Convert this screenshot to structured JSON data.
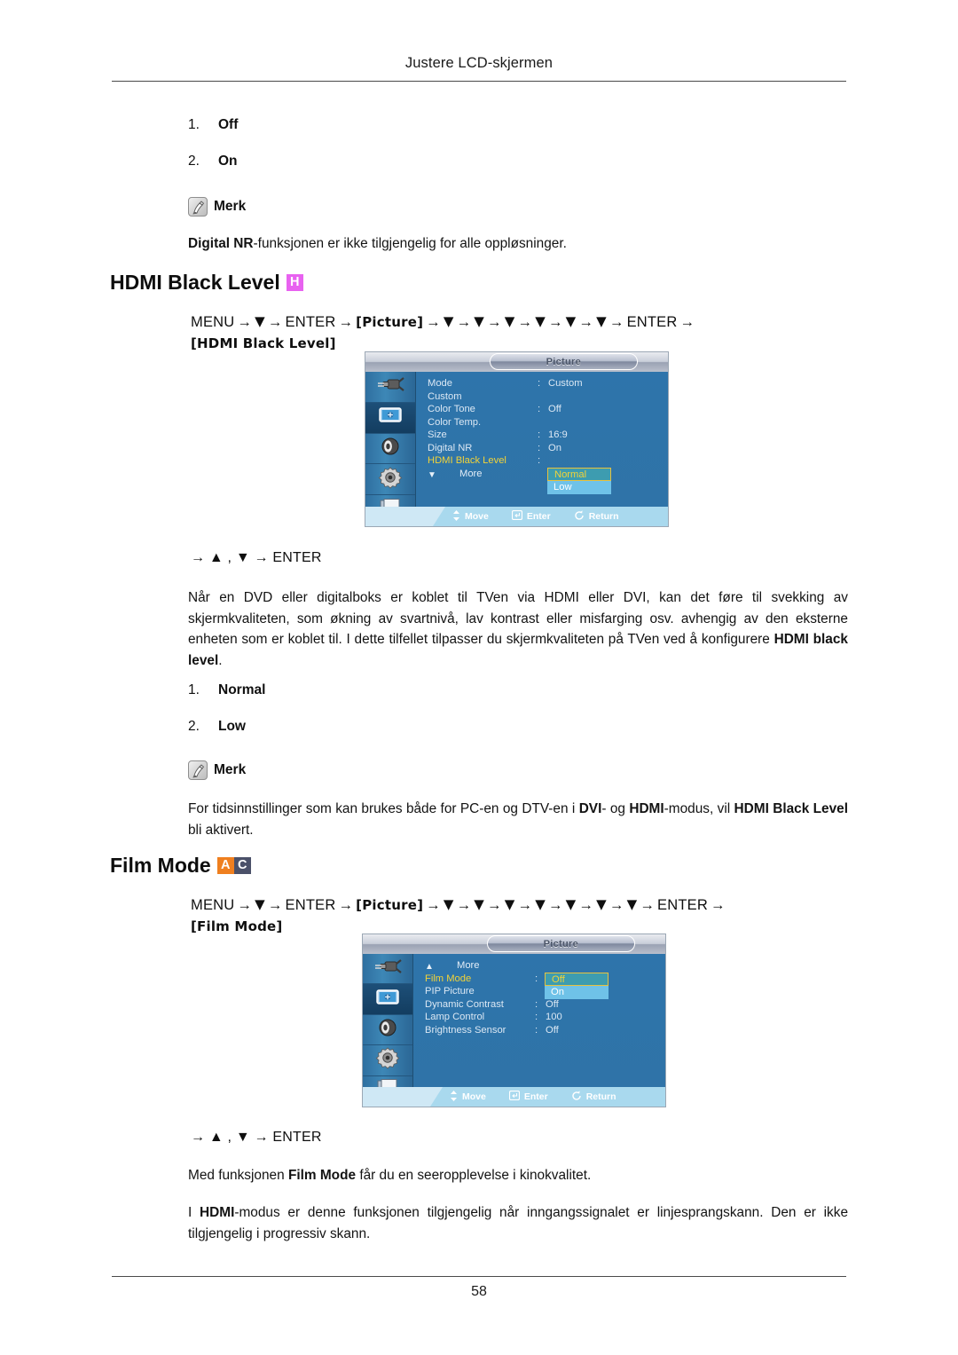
{
  "header": {
    "title": "Justere LCD-skjermen"
  },
  "footer": {
    "page_number": "58"
  },
  "top_section": {
    "items": [
      {
        "num": "1.",
        "label": "Off"
      },
      {
        "num": "2.",
        "label": "On"
      }
    ],
    "note_label": "Merk",
    "note_text": "Digital NR-funksjonen er ikke tilgjengelig for alle oppløsninger.",
    "note_text_bold_prefix": "Digital NR",
    "note_text_rest": "-funksjonen er ikke tilgjengelig for alle oppløsninger."
  },
  "hdmi_section": {
    "heading": "HDMI Black Level",
    "badges": [
      {
        "letter": "H",
        "color": "#e862f0"
      }
    ],
    "menu_path": {
      "prefix": "MENU",
      "enter": "ENTER",
      "picture": "[Picture]",
      "down_count": 6,
      "target": "[HDMI Black Level]",
      "trail_enter": "ENTER"
    },
    "enter_line": "→ ▲ , ▼ → ENTER",
    "paragraph": "Når en DVD eller digitalboks er koblet til TVen via HDMI eller DVI, kan det føre til svekking av skjermkvaliteten, som økning av svartnivå, lav kontrast eller misfarging osv. avhengig av den eksterne enheten som er koblet til. I dette tilfellet tilpasser du skjermkvaliteten på TVen ved å konfigurere HDMI black level.",
    "paragraph_bold_term": "HDMI black level",
    "items": [
      {
        "num": "1.",
        "label": "Normal"
      },
      {
        "num": "2.",
        "label": "Low"
      }
    ],
    "note_label": "Merk",
    "note_text": "For tidsinnstillinger som kan brukes både for PC-en og DTV-en i DVI- og HDMI-modus, vil HDMI Black Level bli aktivert.",
    "osd": {
      "title": "Picture",
      "rows": [
        {
          "label": "Mode",
          "colon": ":",
          "value": "Custom",
          "selected": false
        },
        {
          "label": "Custom",
          "colon": "",
          "value": "",
          "selected": false
        },
        {
          "label": "Color Tone",
          "colon": ":",
          "value": "Off",
          "selected": false
        },
        {
          "label": "Color Temp.",
          "colon": "",
          "value": "",
          "selected": false
        },
        {
          "label": "Size",
          "colon": ":",
          "value": "16:9",
          "selected": false
        },
        {
          "label": "Digital NR",
          "colon": ":",
          "value": "On",
          "selected": false
        },
        {
          "label": "HDMI Black Level",
          "colon": ":",
          "value": "",
          "selected": true
        },
        {
          "label": "More",
          "colon": "",
          "value": "",
          "selected": false,
          "more": true
        }
      ],
      "popup": {
        "highlighted": "Normal",
        "plain": "Low"
      },
      "footer": [
        {
          "icon": "move-icon",
          "label": "Move"
        },
        {
          "icon": "enter-icon",
          "label": "Enter"
        },
        {
          "icon": "return-icon",
          "label": "Return"
        }
      ],
      "rail_icons": [
        "input-plug-icon",
        "picture-screen-icon",
        "sound-speaker-icon",
        "setup-gear-icon",
        "multi-control-document-icon"
      ]
    }
  },
  "film_section": {
    "heading": "Film Mode",
    "badges": [
      {
        "letter": "A",
        "color": "#ef7f1f"
      },
      {
        "letter": "C",
        "color": "#4b5169"
      }
    ],
    "menu_path": {
      "prefix": "MENU",
      "enter": "ENTER",
      "picture": "[Picture]",
      "down_count": 7,
      "target": "[Film Mode]",
      "trail_enter": "ENTER"
    },
    "enter_line": "→ ▲ , ▼ → ENTER",
    "paragraph_1": "Med funksjonen Film Mode får du en seeropplevelse i kinokvalitet.",
    "paragraph_1_bold_term": "Film Mode",
    "paragraph_2": "I HDMI-modus er denne funksjonen tilgjengelig når inngangssignalet er linjesprangskann. Den er ikke tilgjengelig i progressiv skann.",
    "paragraph_2_bold_term": "HDMI",
    "osd": {
      "title": "Picture",
      "rows": [
        {
          "label": "More",
          "colon": "",
          "value": "",
          "selected": false,
          "more_up": true
        },
        {
          "label": "Film Mode",
          "colon": ":",
          "value": "",
          "selected": true
        },
        {
          "label": "PIP Picture",
          "colon": "",
          "value": "",
          "selected": false
        },
        {
          "label": "Dynamic Contrast",
          "colon": ":",
          "value": "Off",
          "selected": false
        },
        {
          "label": "Lamp Control",
          "colon": ":",
          "value": "100",
          "selected": false
        },
        {
          "label": "Brightness Sensor",
          "colon": ":",
          "value": "Off",
          "selected": false
        }
      ],
      "popup": {
        "highlighted": "Off",
        "plain": "On"
      },
      "footer": [
        {
          "icon": "move-icon",
          "label": "Move"
        },
        {
          "icon": "enter-icon",
          "label": "Enter"
        },
        {
          "icon": "return-icon",
          "label": "Return"
        }
      ],
      "rail_icons": [
        "input-plug-icon",
        "picture-screen-icon",
        "sound-speaker-icon",
        "setup-gear-icon",
        "multi-control-document-icon"
      ]
    }
  }
}
